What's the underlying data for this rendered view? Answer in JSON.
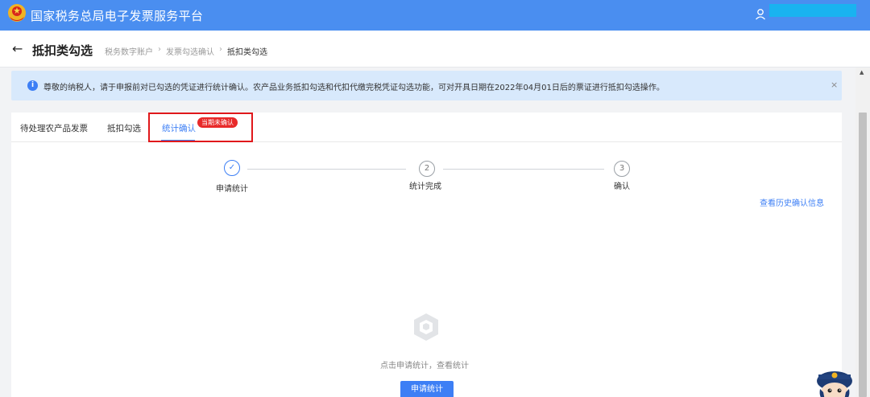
{
  "header": {
    "platform_title": "国家税务总局电子发票服务平台",
    "emblem_icon": "tax-emblem-icon",
    "user_icon": "user-icon",
    "brand_color": "#4a8ef0"
  },
  "page": {
    "title": "抵扣类勾选",
    "back_icon": "back-arrow-icon",
    "back_glyph": "←",
    "breadcrumb": [
      "税务数字账户",
      "发票勾选确认",
      "抵扣类勾选"
    ],
    "breadcrumb_sep": "›"
  },
  "notice": {
    "text": "尊敬的纳税人，请于申报前对已勾选的凭证进行统计确认。农产品业务抵扣勾选和代扣代缴完税凭证勾选功能，可对开具日期在2022年04月01日后的票证进行抵扣勾选操作。",
    "info_glyph": "i",
    "close_glyph": "×"
  },
  "tabs": {
    "items": [
      "待处理农产品发票",
      "抵扣勾选",
      "统计确认"
    ],
    "active_index": 2,
    "badge": "当期未确认"
  },
  "steps": {
    "items": [
      {
        "label": "申请统计",
        "mark": "✓",
        "status": "done"
      },
      {
        "label": "统计完成",
        "mark": "2",
        "status": "pending"
      },
      {
        "label": "确认",
        "mark": "3",
        "status": "pending"
      }
    ]
  },
  "links": {
    "history": "查看历史确认信息"
  },
  "empty_state": {
    "text": "点击申请统计，查看统计",
    "icon": "empty-box-icon"
  },
  "buttons": {
    "apply": "申请统计"
  },
  "colors": {
    "accent": "#3d7ff5",
    "badge": "#e82a2a",
    "notice_bg": "#d8e9fc",
    "highlight": "#e0181b"
  }
}
